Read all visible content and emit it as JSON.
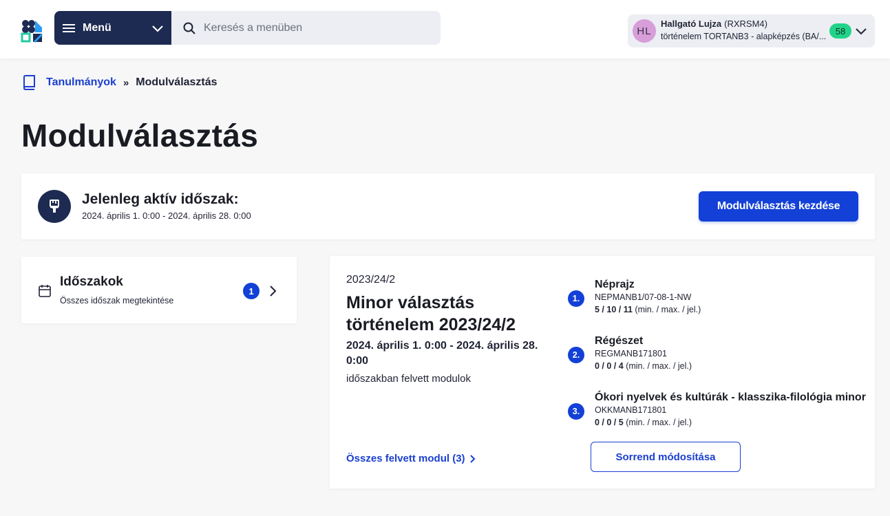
{
  "header": {
    "menu_label": "Menü",
    "search_placeholder": "Keresés a menüben",
    "user": {
      "initials": "HL",
      "name": "Hallgató Lujza",
      "code": "(RXRSM4)",
      "program": "történelem TORTANB3 - alapképzés (BA/...",
      "badge": "58"
    }
  },
  "breadcrumb": {
    "root": "Tanulmányok",
    "separator": "»",
    "current": "Modulválasztás"
  },
  "page_title": "Modulválasztás",
  "active_period": {
    "title": "Jelenleg aktív időszak:",
    "dates": "2024. április 1. 0:00 - 2024. április 28. 0:00",
    "button": "Modulválasztás kezdése"
  },
  "periods_card": {
    "title": "Időszakok",
    "subtitle": "Összes időszak megtekintése",
    "count": "1"
  },
  "selection": {
    "semester": "2023/24/2",
    "title": "Minor választás történelem 2023/24/2",
    "dates": "2024. április 1. 0:00 - 2024. április 28. 0:00",
    "subtitle": "időszakban felvett modulok",
    "all_link": "Összes felvett modul (3)",
    "order_button": "Sorrend módosítása",
    "values_suffix": "(min. / max. / jel.)",
    "modules": [
      {
        "num": "1.",
        "name": "Néprajz",
        "code": "NEPMANB1/07-08-1-NW",
        "values": "5 / 10 / 11"
      },
      {
        "num": "2.",
        "name": "Régészet",
        "code": "REGMANB171801",
        "values": "0 / 0 / 4"
      },
      {
        "num": "3.",
        "name": "Ókori nyelvek és kultúrák - klasszika-filológia minor",
        "code": "OKKMANB171801",
        "values": "0 / 0 / 5"
      }
    ]
  },
  "colors": {
    "navy": "#1d2b52",
    "primary_blue": "#1340d6",
    "link_blue": "#1a3fd1",
    "badge_green": "#22d38a",
    "avatar_pink": "#d79ed9"
  },
  "icons": [
    "app-logo-icon",
    "hamburger-icon",
    "chevron-down-icon",
    "search-icon",
    "book-icon",
    "paint-brush-icon",
    "calendar-icon",
    "chevron-right-icon"
  ]
}
